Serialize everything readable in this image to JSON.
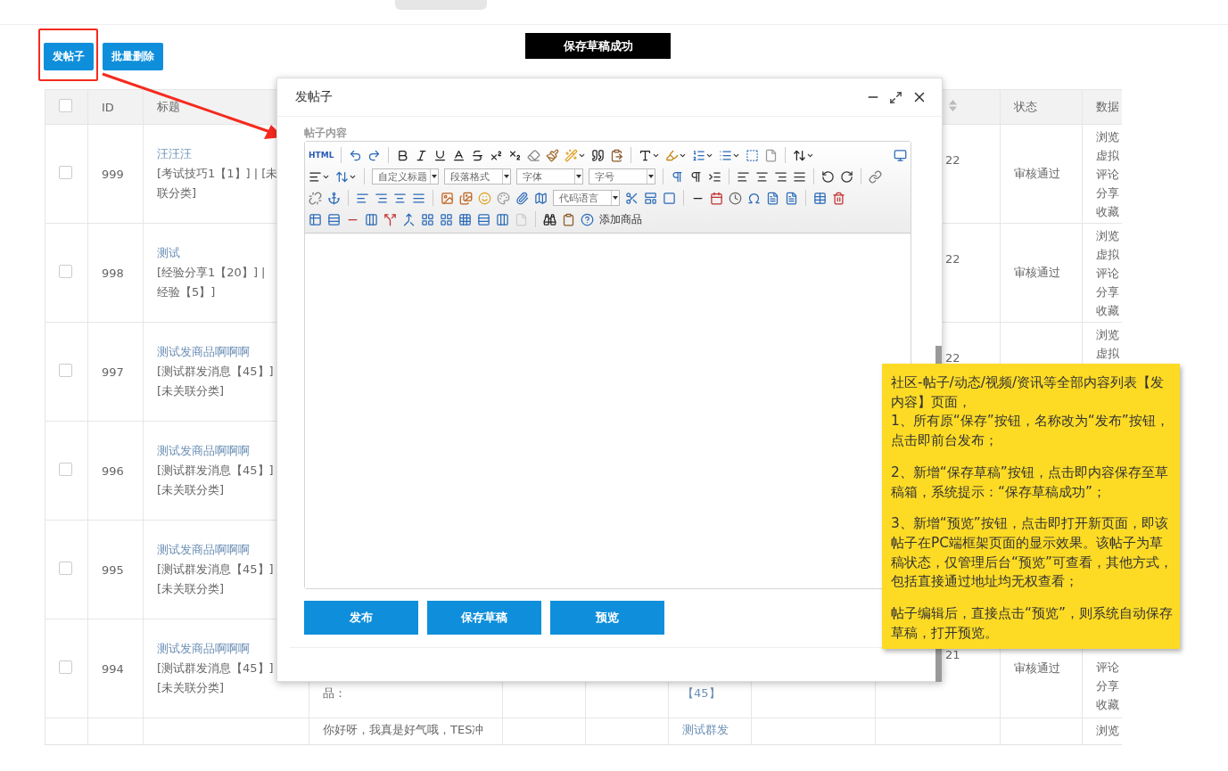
{
  "actions": [
    {
      "label": "发帖子",
      "highlighted": true
    },
    {
      "label": "批量删除",
      "highlighted": false
    }
  ],
  "toast": "保存草稿成功",
  "table": {
    "select_all_checked": false,
    "columns": [
      {
        "kind": "check"
      },
      {
        "kind": "text",
        "label": "ID"
      },
      {
        "kind": "text",
        "label": "标题"
      },
      {
        "kind": "blank"
      },
      {
        "kind": "blank"
      },
      {
        "kind": "blank"
      },
      {
        "kind": "blank"
      },
      {
        "kind": "blank"
      },
      {
        "kind": "sort"
      },
      {
        "kind": "text",
        "label": "状态"
      },
      {
        "kind": "text",
        "label": "数据"
      }
    ],
    "rows": [
      {
        "checked": false,
        "id": "999",
        "title": [
          "汪汪汪",
          "[考试技巧1【1】] | [未",
          "联分类]"
        ],
        "column_9": "22",
        "status": "审核通过",
        "stats": [
          "浏览",
          "虚拟",
          "评论",
          "分享",
          "收藏"
        ]
      },
      {
        "checked": false,
        "id": "998",
        "title": [
          "测试",
          "[经验分享1【20】] |",
          "经验【5】]"
        ],
        "column_9": "22",
        "status": "审核通过",
        "stats": [
          "浏览",
          "虚拟",
          "评论",
          "分享",
          "收藏"
        ]
      },
      {
        "checked": false,
        "id": "997",
        "title": [
          "测试发商品啊啊啊",
          "[测试群发消息【45】]",
          "[未关联分类]"
        ],
        "column_9": "22",
        "stats": [
          "浏览",
          "虚拟"
        ]
      },
      {
        "checked": false,
        "id": "996",
        "title": [
          "测试发商品啊啊啊",
          "[测试群发消息【45】]",
          "[未关联分类]"
        ]
      },
      {
        "checked": false,
        "id": "995",
        "title": [
          "测试发商品啊啊啊",
          "[测试群发消息【45】]",
          "[未关联分类]"
        ]
      },
      {
        "checked": false,
        "id": "994",
        "title": [
          "测试发商品啊啊啊",
          "[测试群发消息【45】]",
          "[未关联分类]"
        ],
        "column_4": "品：",
        "column_7": "【45】",
        "column_9": "21",
        "status": "审核通过",
        "stats": [
          "评论",
          "分享",
          "收藏"
        ]
      },
      {
        "column_4": "你好呀，我真是好气哦，TES冲",
        "column_7": "测试群发",
        "stats": [
          "浏览"
        ]
      }
    ]
  },
  "dialog": {
    "title": "发帖子",
    "field_label": "帖子内容",
    "html_label": "HTML",
    "selects": [
      "自定义标题",
      "段落格式",
      "字体",
      "字号"
    ],
    "code_select": "代码语言",
    "add_goods": "添加商品",
    "buttons": [
      "发布",
      "保存草稿",
      "预览"
    ]
  },
  "note": [
    [
      "社区-帖子/动态/视频/资讯等全部内容列表【发内容】页面，",
      "1、所有原“保存”按钮，名称改为“发布”按钮，点击即前台发布；"
    ],
    [
      "2、新增“保存草稿”按钮，点击即内容保存至草稿箱，系统提示：“保存草稿成功”；"
    ],
    [
      "3、新增“预览”按钮，点击即打开新页面，即该帖子在PC端框架页面的显示效果。该帖子为草稿状态，仅管理后台“预览”可查看，其他方式，包括直接通过地址均无权查看；"
    ],
    [
      "帖子编辑后，直接点击“预览”，则系统自动保存草稿，打开预览。"
    ]
  ]
}
